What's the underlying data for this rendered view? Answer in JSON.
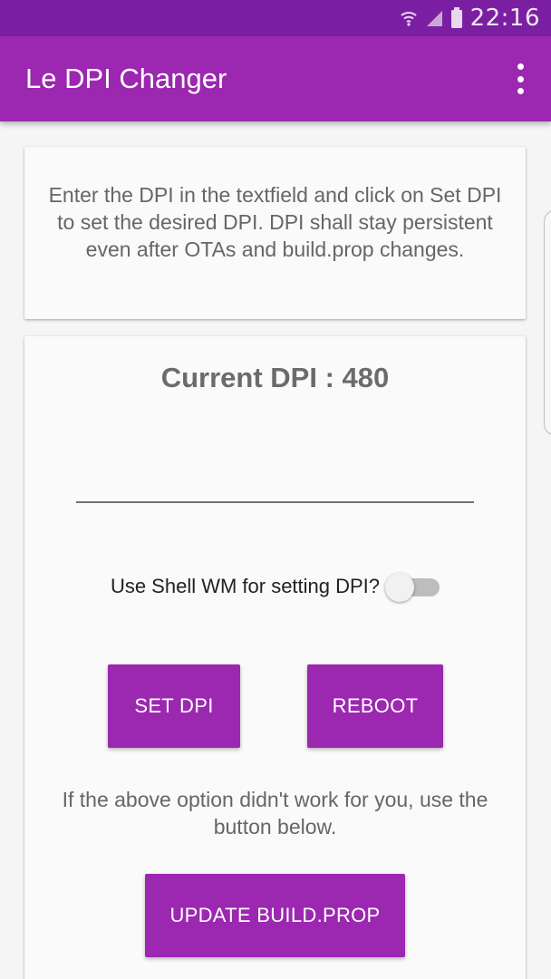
{
  "status_bar": {
    "time": "22:16"
  },
  "app_bar": {
    "title": "Le DPI Changer"
  },
  "info_card": {
    "text": "Enter the DPI in the textfield and click on Set DPI to set the desired DPI. DPI shall stay persistent even after OTAs and build.prop changes."
  },
  "main_card": {
    "current_dpi": "Current DPI : 480",
    "dpi_input": {
      "value": "",
      "placeholder": ""
    },
    "switch": {
      "label": "Use Shell WM for setting DPI?",
      "checked": false
    },
    "set_dpi_label": "SET DPI",
    "reboot_label": "REBOOT",
    "alt_text": "If the above option didn't work for you, use the button below.",
    "update_label": "UPDATE BUILD.PROP"
  },
  "colors": {
    "primary": "#9c27b0",
    "primary_dark": "#7b1fa2",
    "text_secondary": "#666666"
  }
}
